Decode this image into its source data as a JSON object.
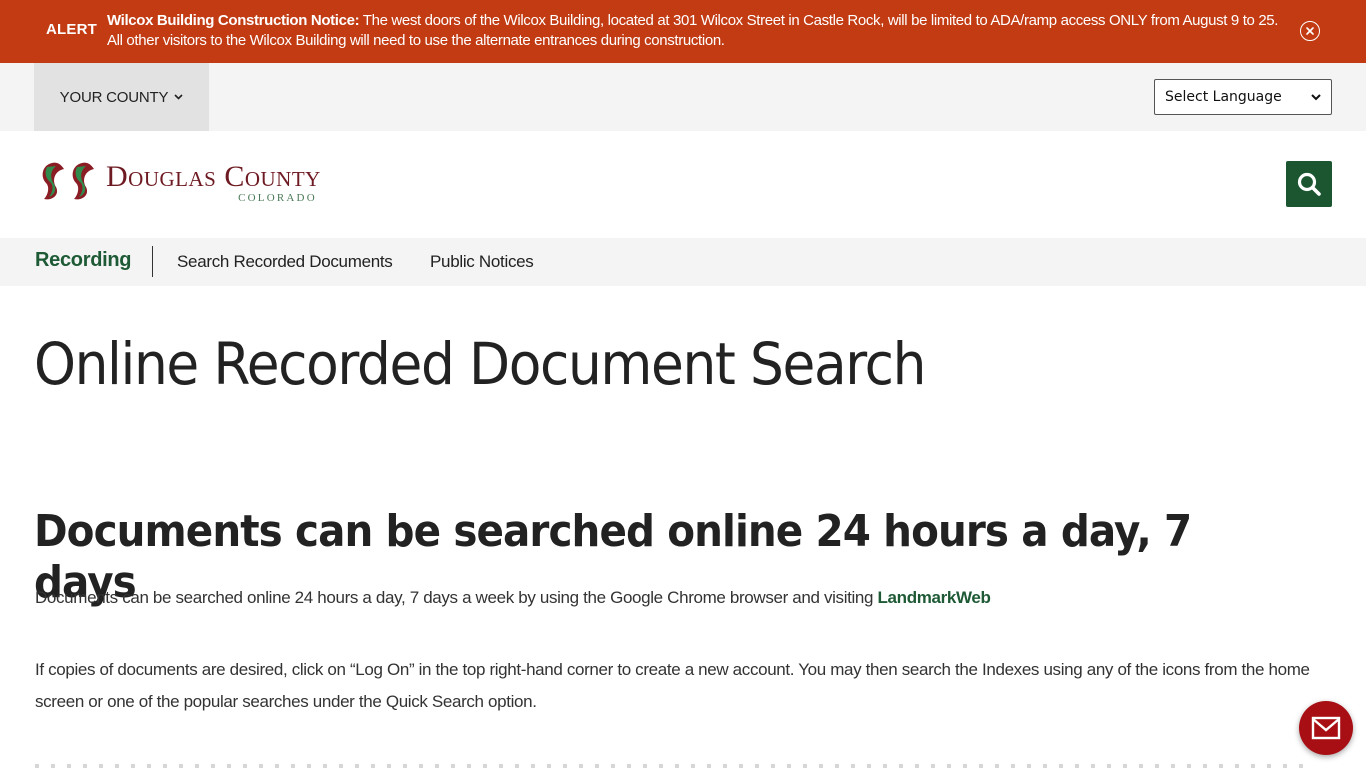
{
  "alert": {
    "label": "ALERT",
    "title": "Wilcox Building Construction Notice:",
    "message": " The west doors of the Wilcox Building, located at 301 Wilcox Street in Castle Rock, will be limited to ADA/ramp access ONLY from August 9 to 25.   All other visitors to the Wilcox Building will need to use the alternate entrances during construction.",
    "close_icon": "close-circle-icon"
  },
  "utility_bar": {
    "county_menu_label": "YOUR COUNTY",
    "language_select": {
      "selected": "Select Language"
    }
  },
  "header": {
    "logo_name": "Douglas County",
    "logo_sub": "COLORADO",
    "search_icon": "search-icon"
  },
  "subnav": {
    "title": "Recording",
    "links": [
      {
        "label": "Search Recorded Documents"
      },
      {
        "label": "Public Notices"
      }
    ]
  },
  "main": {
    "page_title": "Online Recorded Document Search",
    "section_heading": "Documents can be searched online 24 hours a day, 7 days",
    "paragraphs": {
      "p1_text": "Documents can be searched online 24 hours a day, 7 days a week by using the Google Chrome browser and visiting ",
      "p1_link": "LandmarkWeb",
      "p2_text": "If copies of documents are desired, click on “Log On” in the top right-hand corner to create a new account. You may then search the Indexes using any of the icons from the home screen or one of the popular searches under the Quick Search option."
    }
  },
  "chat": {
    "icon": "envelope-icon"
  },
  "colors": {
    "alert_bg": "#c23b13",
    "brand_green": "#1b5631",
    "brand_maroon": "#6e1a22",
    "chat_red": "#a80f14"
  }
}
